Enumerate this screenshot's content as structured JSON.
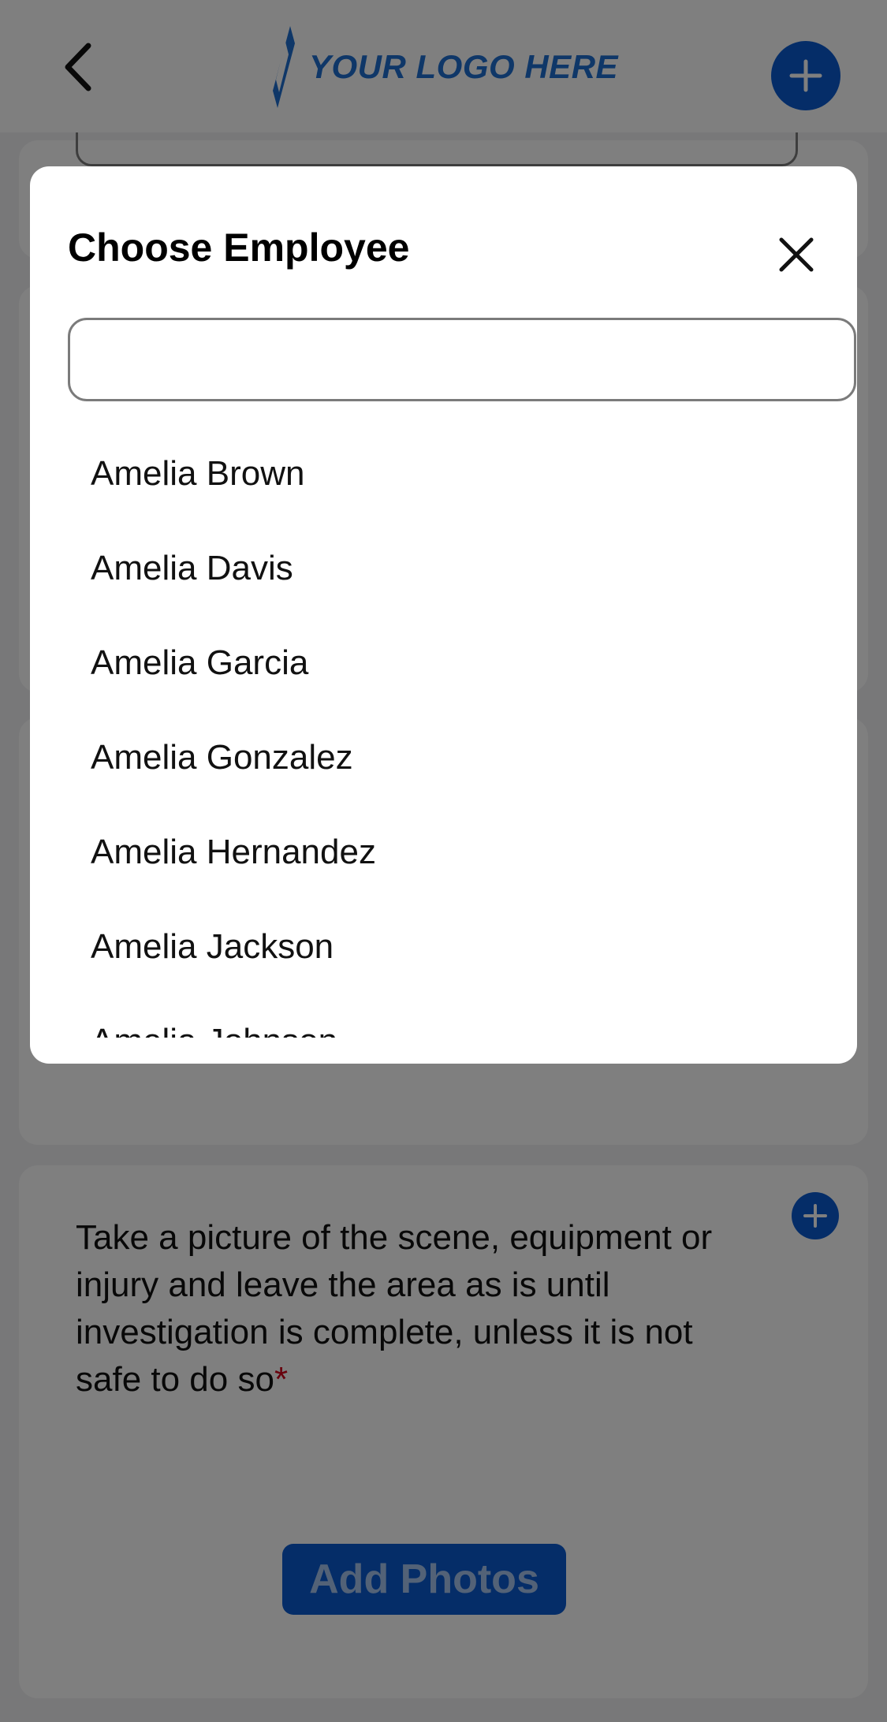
{
  "header": {
    "logo_text": "YOUR LOGO HERE"
  },
  "photo_section": {
    "question": "Take a picture of the scene, equipment or injury and leave the area as is until investigation is complete, unless it is not safe to do so",
    "required_marker": "*",
    "add_photos_label": "Add Photos"
  },
  "modal": {
    "title": "Choose Employee",
    "search": {
      "value": "",
      "placeholder": ""
    },
    "employees": [
      "Amelia Brown",
      "Amelia Davis",
      "Amelia Garcia",
      "Amelia Gonzalez",
      "Amelia Hernandez",
      "Amelia Jackson",
      "Amelia Johnson"
    ]
  },
  "colors": {
    "accent": "#0a5bd1",
    "logo": "#1f6fd1",
    "required": "#d0021b",
    "scrim": "rgba(0,0,0,0.5)"
  },
  "icons": {
    "back": "chevron-left-icon",
    "add": "plus-icon",
    "close": "close-icon"
  }
}
